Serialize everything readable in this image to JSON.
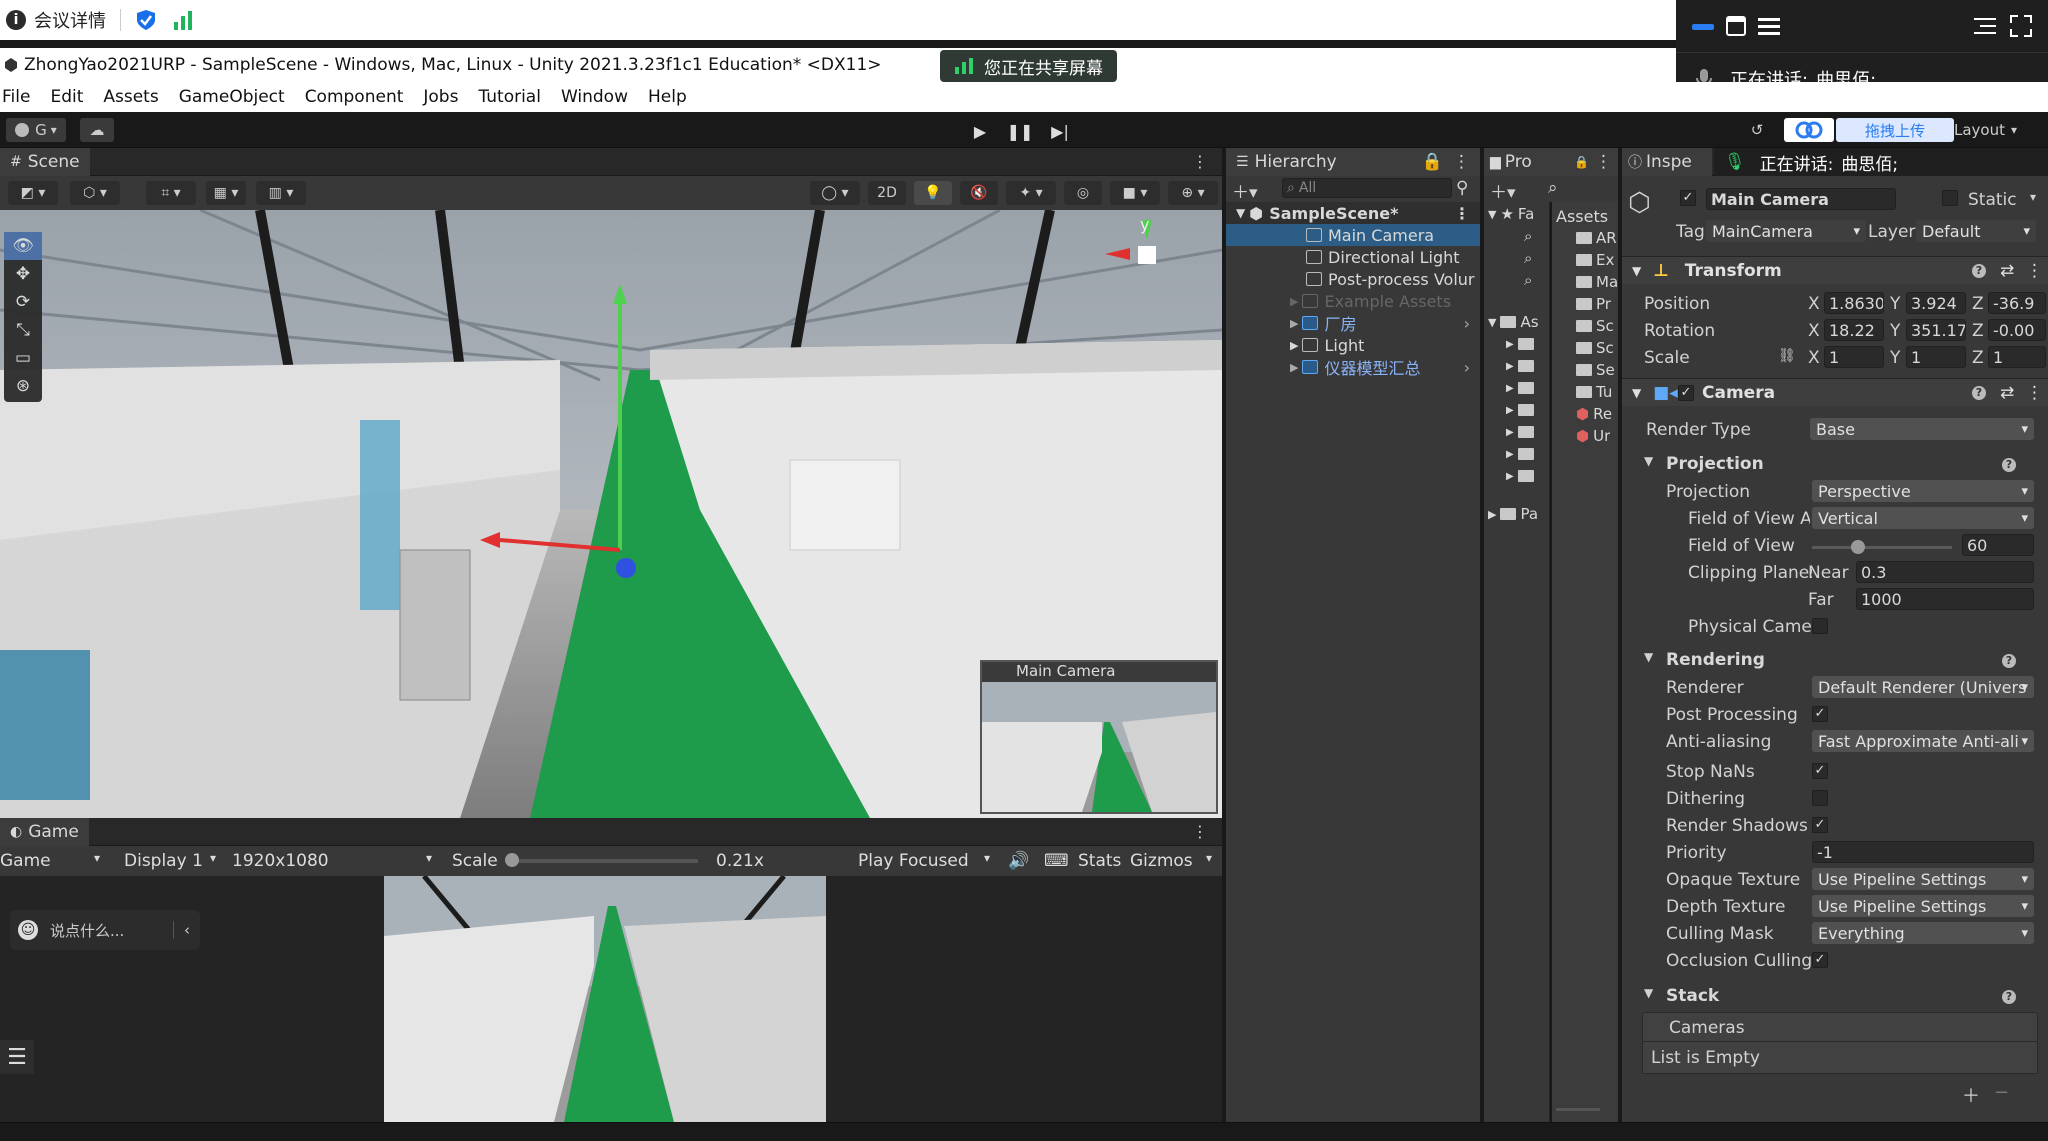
{
  "meeting": {
    "details_label": "会议详情",
    "sharing_text": "您正在共享屏幕",
    "speaking_label": "正在讲话:",
    "speaking_name": "曲思佰;",
    "upload_label": "拖拽上传"
  },
  "window": {
    "title": "ZhongYao2021URP - SampleScene - Windows, Mac, Linux - Unity 2021.3.23f1c1 Education* <DX11>"
  },
  "menu": [
    "File",
    "Edit",
    "Assets",
    "GameObject",
    "Component",
    "Jobs",
    "Tutorial",
    "Window",
    "Help"
  ],
  "toolbar": {
    "account": "G",
    "layout_label": "Layout"
  },
  "scene": {
    "tab_label": "Scene",
    "mode_2d": "2D",
    "gizmo_axis": "y",
    "camera_preview_title": "Main Camera"
  },
  "game": {
    "tab_label": "Game",
    "view_select": "Game",
    "display": "Display 1",
    "resolution": "1920x1080",
    "scale_label": "Scale",
    "scale_value": "0.21x",
    "scale_level": 0.02,
    "play_focused": "Play Focused",
    "stats": "Stats",
    "gizmos": "Gizmos",
    "chat_placeholder": "说点什么..."
  },
  "hierarchy": {
    "tab_label": "Hierarchy",
    "search_placeholder": "All",
    "scene_name": "SampleScene*",
    "items": [
      {
        "label": "Main Camera",
        "kind": "object"
      },
      {
        "label": "Directional Light",
        "kind": "object"
      },
      {
        "label": "Post-process Volur",
        "kind": "object"
      },
      {
        "label": "Example Assets",
        "kind": "disabled"
      },
      {
        "label": "厂房",
        "kind": "prefab"
      },
      {
        "label": "Light",
        "kind": "object"
      },
      {
        "label": "仪器模型汇总",
        "kind": "prefab"
      }
    ]
  },
  "project": {
    "tab_label": "Pro",
    "favorites_label": "Fa",
    "assets_label": "As",
    "packages_label": "Pa",
    "breadcrumb": "Assets",
    "right_items": [
      "AR",
      "Ex",
      "Ma",
      "Pr",
      "Sc",
      "Sc",
      "Se",
      "Tu",
      "Re",
      "Ur"
    ]
  },
  "inspector": {
    "tab_label": "Inspe",
    "object_name": "Main Camera",
    "static_label": "Static",
    "tag_label": "Tag",
    "tag_value": "MainCamera",
    "layer_label": "Layer",
    "layer_value": "Default",
    "transform": {
      "title": "Transform",
      "position_label": "Position",
      "rotation_label": "Rotation",
      "scale_label": "Scale",
      "position": {
        "x": "1.8630",
        "y": "3.924",
        "z": "-36.9"
      },
      "rotation": {
        "x": "18.22",
        "y": "351.17",
        "z": "-0.00"
      },
      "scale": {
        "x": "1",
        "y": "1",
        "z": "1"
      }
    },
    "camera": {
      "title": "Camera",
      "render_type_label": "Render Type",
      "render_type": "Base",
      "projection_section": "Projection",
      "projection_label": "Projection",
      "projection_value": "Perspective",
      "fov_axis_label": "Field of View Ax",
      "fov_axis_value": "Vertical",
      "fov_label": "Field of View",
      "fov_value": "60",
      "fov_level": 0.33,
      "clipping_label": "Clipping Planes",
      "near_label": "Near",
      "near_value": "0.3",
      "far_label": "Far",
      "far_value": "1000",
      "physical_label": "Physical Camer",
      "rendering_section": "Rendering",
      "renderer_label": "Renderer",
      "renderer_value": "Default Renderer (Univers",
      "post_label": "Post Processing",
      "aa_label": "Anti-aliasing",
      "aa_value": "Fast Approximate Anti-ali",
      "nan_label": "Stop NaNs",
      "dither_label": "Dithering",
      "shadows_label": "Render Shadows",
      "priority_label": "Priority",
      "priority_value": "-1",
      "opaque_label": "Opaque Texture",
      "opaque_value": "Use Pipeline Settings",
      "depth_label": "Depth Texture",
      "depth_value": "Use Pipeline Settings",
      "culling_label": "Culling Mask",
      "culling_value": "Everything",
      "occlusion_label": "Occlusion Culling",
      "stack_section": "Stack",
      "cameras_label": "Cameras",
      "empty_label": "List is Empty"
    }
  }
}
